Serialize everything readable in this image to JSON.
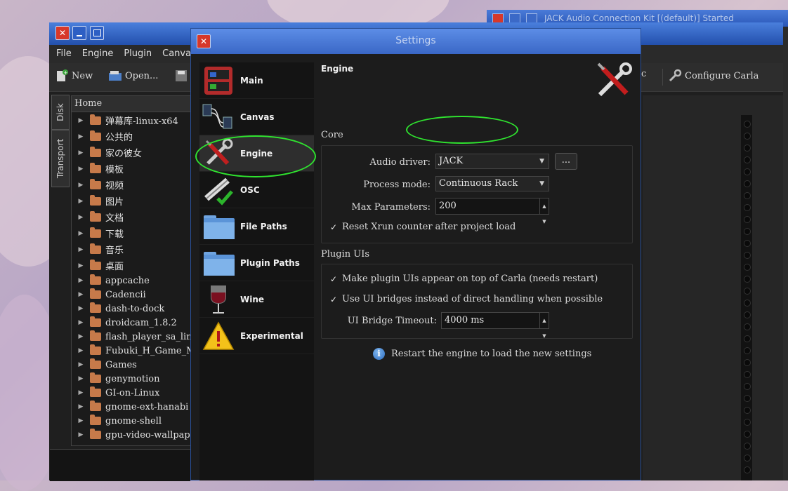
{
  "jack_window": {
    "title": "JACK Audio Connection Kit [(default)] Started"
  },
  "carla": {
    "menu": [
      "File",
      "Engine",
      "Plugin",
      "Canvas"
    ],
    "toolbar": {
      "new": "New",
      "open": "Open...",
      "configure": "Configure Carla",
      "partial_c": "c"
    },
    "side_tabs": [
      "Disk",
      "Transport"
    ],
    "tree_header": "Home",
    "tree_items": [
      "弹幕库-linux-x64",
      "公共的",
      "家の彼女",
      "模板",
      "视频",
      "图片",
      "文档",
      "下载",
      "音乐",
      "桌面",
      "appcache",
      "Cadencii",
      "dash-to-dock",
      "droidcam_1.8.2",
      "flash_player_sa_linux",
      "Fubuki_H_Game_M",
      "Games",
      "genymotion",
      "GI-on-Linux",
      "gnome-ext-hanabi",
      "gnome-shell",
      "gpu-video-wallpaper"
    ]
  },
  "settings": {
    "title": "Settings",
    "nav": [
      {
        "label": "Main",
        "icon": "main-icon"
      },
      {
        "label": "Canvas",
        "icon": "canvas-icon"
      },
      {
        "label": "Engine",
        "icon": "engine-icon"
      },
      {
        "label": "OSC",
        "icon": "osc-icon"
      },
      {
        "label": "File Paths",
        "icon": "folder-icon"
      },
      {
        "label": "Plugin Paths",
        "icon": "folder-icon"
      },
      {
        "label": "Wine",
        "icon": "wine-icon"
      },
      {
        "label": "Experimental",
        "icon": "warning-icon"
      }
    ],
    "active_nav": "Engine",
    "page_title": "Engine",
    "core": {
      "group_title": "Core",
      "audio_driver_label": "Audio driver:",
      "audio_driver_value": "JACK",
      "driver_options_button": "...",
      "process_mode_label": "Process mode:",
      "process_mode_value": "Continuous Rack",
      "max_params_label": "Max Parameters:",
      "max_params_value": "200",
      "reset_xrun_label": "Reset Xrun counter after project load",
      "reset_xrun_checked": true
    },
    "plugin_uis": {
      "group_title": "Plugin UIs",
      "on_top_label": "Make plugin UIs appear on top of Carla (needs restart)",
      "on_top_checked": true,
      "ui_bridges_label": "Use UI bridges instead of direct handling when possible",
      "ui_bridges_checked": true,
      "bridge_timeout_label": "UI Bridge Timeout:",
      "bridge_timeout_value": "4000 ms"
    },
    "info_text": "Restart the engine to load the new settings",
    "highlight_color": "#2fe32f"
  }
}
